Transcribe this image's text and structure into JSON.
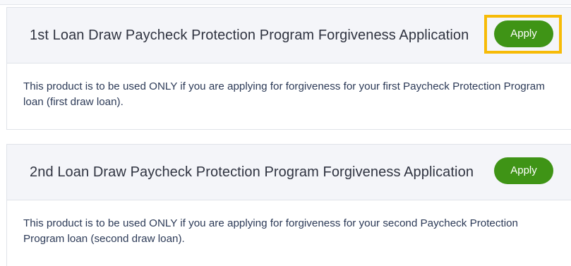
{
  "products": [
    {
      "title": "1st Loan Draw Paycheck Protection Program Forgiveness Application",
      "apply_label": "Apply",
      "description": "This product is to be used ONLY if you are applying for forgiveness for your first Paycheck Protection Program loan (first draw loan)."
    },
    {
      "title": "2nd Loan Draw Paycheck Protection Program Forgiveness Application",
      "apply_label": "Apply",
      "description": "This product is to be used ONLY if you are applying for forgiveness for your second Paycheck Protection Program loan (second draw loan)."
    }
  ],
  "colors": {
    "apply_button": "#3f9416",
    "highlight": "#f7bb07",
    "header_bg": "#f4f5f9",
    "description_text": "#2c3a57"
  }
}
